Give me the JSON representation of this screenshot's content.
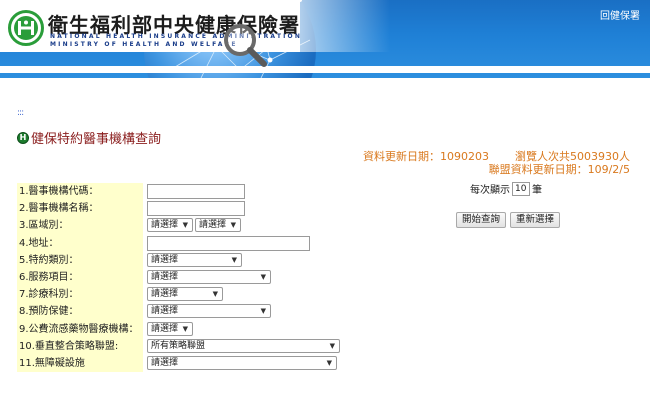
{
  "header": {
    "title": "衛生福利部中央健康保險署",
    "subtitle_line1": "NATIONAL HEALTH INSURANCE ADMINISTRATION",
    "subtitle_line2": "MINISTRY OF HEALTH AND WELFARE",
    "home_link": "回健保署"
  },
  "breadcrumb": ":::",
  "page_title": "健保特約醫事機構查詢",
  "stats": {
    "update_label": "資料更新日期：",
    "update_value": "1090203",
    "visits_text": "瀏覽人次共5003930人",
    "alliance_label": "聯盟資料更新日期：",
    "alliance_value": "109/2/5"
  },
  "form": {
    "rows": [
      {
        "label": "1.醫事機構代碼："
      },
      {
        "label": "2.醫事機構名稱："
      },
      {
        "label": "3.區域別：",
        "select_a": "請選擇",
        "select_b": "請選擇"
      },
      {
        "label": "4.地址："
      },
      {
        "label": "5.特約類別：",
        "select": "請選擇"
      },
      {
        "label": "6.服務項目：",
        "select": "請選擇"
      },
      {
        "label": "7.診療科別：",
        "select": "請選擇"
      },
      {
        "label": "8.預防保健：",
        "select": "請選擇"
      },
      {
        "label": "9.公費流感藥物醫療機構：",
        "select": "請選擇"
      },
      {
        "label": "10.垂直整合策略聯盟:",
        "select": "所有策略聯盟"
      },
      {
        "label": "11.無障礙設施",
        "select": "請選擇"
      }
    ]
  },
  "controls": {
    "per_page_label": "每次顯示",
    "per_page_value": "10",
    "per_page_unit": "筆",
    "search_button": "開始查詢",
    "reset_button": "重新選擇"
  },
  "colors": {
    "header_blue": "#1f80d6",
    "title_red": "#8a1d1d",
    "stats_orange": "#d9791e",
    "label_bg": "#ffffcc"
  }
}
